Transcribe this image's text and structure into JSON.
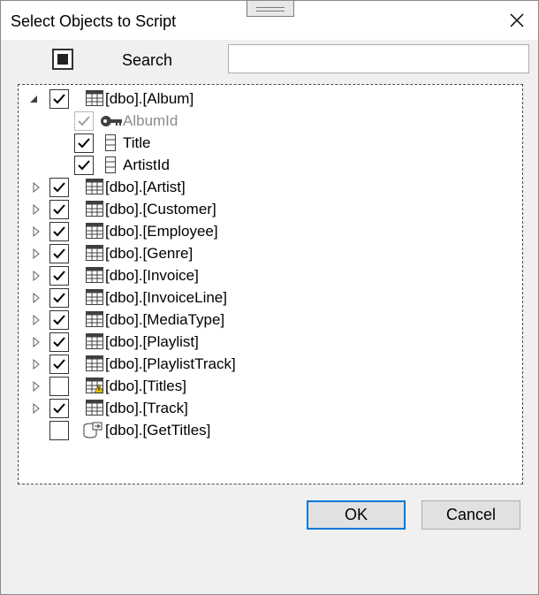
{
  "dialog": {
    "title": "Select Objects to Script"
  },
  "search": {
    "label": "Search",
    "value": "",
    "placeholder": ""
  },
  "tree": {
    "album": {
      "label": "[dbo].[Album]",
      "checked": true,
      "expanded": true,
      "columns": [
        {
          "label": "AlbumId",
          "checked": true,
          "disabled": true,
          "key": true
        },
        {
          "label": "Title",
          "checked": true,
          "disabled": false,
          "key": false
        },
        {
          "label": "ArtistId",
          "checked": true,
          "disabled": false,
          "key": false
        }
      ]
    },
    "items": [
      {
        "label": "[dbo].[Artist]",
        "checked": true,
        "icon": "table-icon"
      },
      {
        "label": "[dbo].[Customer]",
        "checked": true,
        "icon": "table-icon"
      },
      {
        "label": "[dbo].[Employee]",
        "checked": true,
        "icon": "table-icon"
      },
      {
        "label": "[dbo].[Genre]",
        "checked": true,
        "icon": "table-icon"
      },
      {
        "label": "[dbo].[Invoice]",
        "checked": true,
        "icon": "table-icon"
      },
      {
        "label": "[dbo].[InvoiceLine]",
        "checked": true,
        "icon": "table-icon"
      },
      {
        "label": "[dbo].[MediaType]",
        "checked": true,
        "icon": "table-icon"
      },
      {
        "label": "[dbo].[Playlist]",
        "checked": true,
        "icon": "table-icon"
      },
      {
        "label": "[dbo].[PlaylistTrack]",
        "checked": true,
        "icon": "table-icon"
      },
      {
        "label": "[dbo].[Titles]",
        "checked": false,
        "icon": "table-warning-icon"
      },
      {
        "label": "[dbo].[Track]",
        "checked": true,
        "icon": "table-icon"
      }
    ],
    "procedure": {
      "label": "[dbo].[GetTitles]",
      "checked": false,
      "icon": "stored-procedure-icon"
    }
  },
  "buttons": {
    "ok": "OK",
    "cancel": "Cancel"
  },
  "colors": {
    "accent": "#0078d7",
    "warning": "#f2c200"
  }
}
